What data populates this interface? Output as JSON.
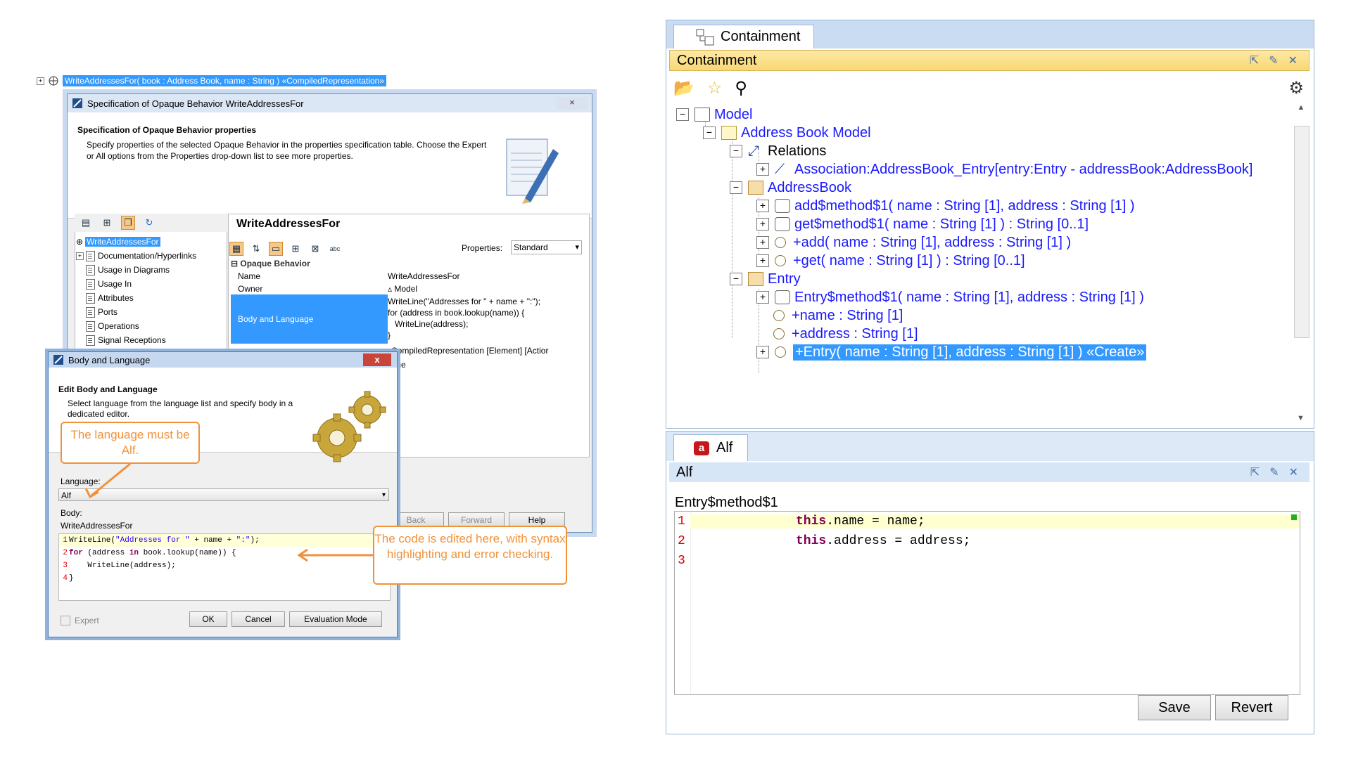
{
  "left": {
    "tree_row": {
      "expand": "+",
      "label": "WriteAddressesFor( book : Address Book, name : String ) «CompiledRepresentation»"
    },
    "spec_dialog": {
      "title": "Specification of Opaque Behavior WriteAddressesFor",
      "close": "×",
      "header_title": "Specification of Opaque Behavior properties",
      "header_desc": "Specify properties of the selected Opaque Behavior in the properties specification table. Choose the Expert or All options from the Properties drop-down list to see more properties.",
      "nav_items": [
        "WriteAddressesFor",
        "Documentation/Hyperlinks",
        "Usage in Diagrams",
        "Usage In",
        "Attributes",
        "Ports",
        "Operations",
        "Signal Receptions"
      ],
      "panel_title": "WriteAddressesFor",
      "properties_label": "Properties:",
      "properties_value": "Standard",
      "group": "Opaque Behavior",
      "rows": [
        {
          "key": "Name",
          "value": "WriteAddressesFor"
        },
        {
          "key": "Owner",
          "value": "Model"
        }
      ],
      "body_lang_key": "Body and Language",
      "body_lang_value": "WriteLine(\"Addresses for \" + name + \":\");\nfor (address in book.lookup(name)) {\n   WriteLine(address);\n}",
      "compiled_row": "CompiledRepresentation [Element] [Actior",
      "true_row": "true",
      "buttons": {
        "back": "Back",
        "forward": "Forward",
        "help": "Help"
      }
    },
    "body_lang_dialog": {
      "title": "Body and Language",
      "close": "x",
      "header_title": "Edit Body and Language",
      "header_desc": "Select language from the language list and specify body in a dedicated editor.",
      "language_label": "Language:",
      "language_value": "Alf",
      "body_label": "Body:",
      "body_name": "WriteAddressesFor",
      "code_lines": [
        {
          "n": "1",
          "text": "WriteLine(\"Addresses for \" + name + \":\");"
        },
        {
          "n": "2",
          "text": "for (address in book.lookup(name)) {"
        },
        {
          "n": "3",
          "text": "    WriteLine(address);"
        },
        {
          "n": "4",
          "text": "}"
        }
      ],
      "expert_label": "Expert",
      "buttons": {
        "ok": "OK",
        "cancel": "Cancel",
        "eval": "Evaluation Mode"
      }
    },
    "callouts": {
      "language": "The language must be Alf.",
      "code": "The code is edited here, with syntax highlighting and error checking."
    }
  },
  "right": {
    "containment": {
      "tab_label": "Containment",
      "header_label": "Containment",
      "tree": {
        "model": "Model",
        "address_book_model": "Address Book Model",
        "relations": "Relations",
        "association": "Association:AddressBook_Entry[entry:Entry - addressBook:AddressBook]",
        "address_book": "AddressBook",
        "add_method": "add$method$1( name : String [1], address : String [1] )",
        "get_method": "get$method$1( name : String [1] ) : String [0..1]",
        "add_op": "+add( name : String [1], address : String [1] )",
        "get_op": "+get( name : String [1] ) : String [0..1]",
        "entry": "Entry",
        "entry_method": "Entry$method$1( name : String [1], address : String [1] )",
        "name_attr": "+name : String [1]",
        "address_attr": "+address : String [1]",
        "entry_ctor": "+Entry( name : String [1], address : String [1] ) «Create»"
      }
    },
    "alf": {
      "tab_label": "Alf",
      "icon_letter": "a",
      "header_label": "Alf",
      "behavior_name": "Entry$method$1",
      "lines": [
        {
          "n": "1",
          "kw": "this",
          "rest": ".name = name;"
        },
        {
          "n": "2",
          "kw": "this",
          "rest": ".address = address;"
        },
        {
          "n": "3",
          "kw": "",
          "rest": ""
        }
      ],
      "buttons": {
        "save": "Save",
        "revert": "Revert"
      }
    }
  },
  "colors": {
    "selection": "#3399ff",
    "callout": "#f0923a",
    "header_gold": "#f9d774",
    "keyword": "#7f0055"
  }
}
